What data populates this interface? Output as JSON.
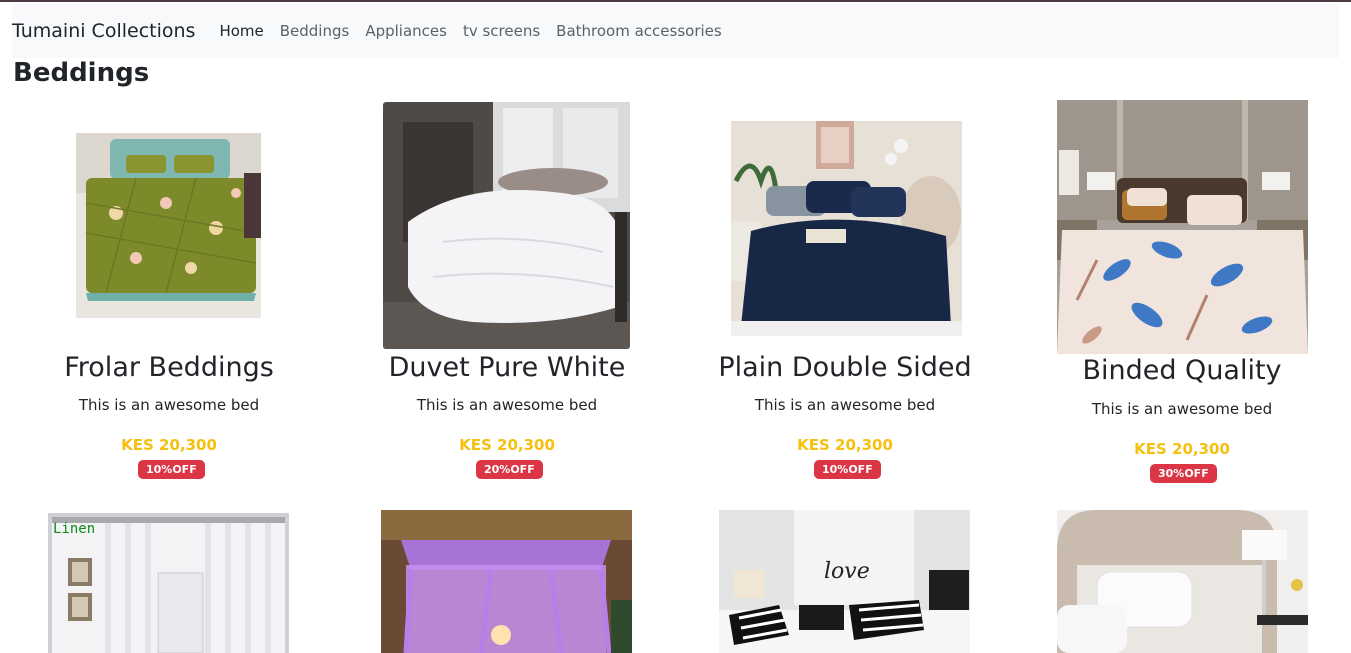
{
  "navbar": {
    "brand": "Tumaini Collections",
    "links": [
      {
        "label": "Home",
        "active": true
      },
      {
        "label": "Beddings",
        "active": false
      },
      {
        "label": "Appliances",
        "active": false
      },
      {
        "label": "tv screens",
        "active": false
      },
      {
        "label": "Bathroom accessories",
        "active": false
      }
    ]
  },
  "page": {
    "section_title": "Beddings"
  },
  "products": [
    {
      "name": "Frolar Beddings",
      "description": "This is an awesome bed",
      "price": "KES 20,300",
      "discount": "10%OFF"
    },
    {
      "name": "Duvet Pure White",
      "description": "This is an awesome bed",
      "price": "KES 20,300",
      "discount": "20%OFF"
    },
    {
      "name": "Plain Double Sided",
      "description": "This is an awesome bed",
      "price": "KES 20,300",
      "discount": "10%OFF"
    },
    {
      "name": "Binded Quality",
      "description": "This is an awesome bed",
      "price": "KES 20,300",
      "discount": "30%OFF"
    }
  ],
  "second_row_images": [
    {
      "image_label": "Linen"
    },
    {
      "image_label": ""
    },
    {
      "image_label": "love"
    },
    {
      "image_label": ""
    }
  ],
  "colors": {
    "price": "#f5c010",
    "badge": "#dc3545",
    "navbar_bg": "#f8f9fa"
  }
}
